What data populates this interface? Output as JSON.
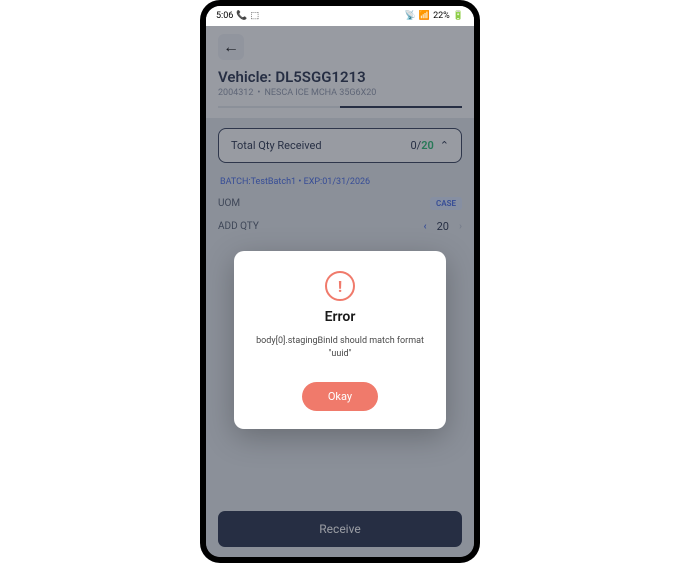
{
  "statusbar": {
    "time": "5:06",
    "call_icon": "📞",
    "extra_left": "⬚",
    "signal": "📶",
    "wifi": "📡",
    "battery_pct": "22%",
    "battery_icon": "🔋"
  },
  "header": {
    "back_glyph": "←",
    "title": "Vehicle: DL5SGG1213",
    "sub_id": "2004312",
    "sub_sep": "•",
    "sub_desc": "NESCA ICE MCHA 35G6X20"
  },
  "qty_card": {
    "label": "Total Qty Received",
    "received": "0",
    "slash": "/",
    "total": "20",
    "caret": "⌃"
  },
  "batch": {
    "label": "BATCH:TestBatch1",
    "sep": "•",
    "exp": "EXP:01/31/2026"
  },
  "uom": {
    "label": "UOM",
    "value": "CASE"
  },
  "addqty": {
    "label": "ADD QTY",
    "value": "20",
    "left": "‹",
    "right": "›"
  },
  "bottom_button": "Receive",
  "modal": {
    "icon": "!",
    "title": "Error",
    "message": "body[0].stagingBinId should match format \"uuid\"",
    "button": "Okay"
  }
}
